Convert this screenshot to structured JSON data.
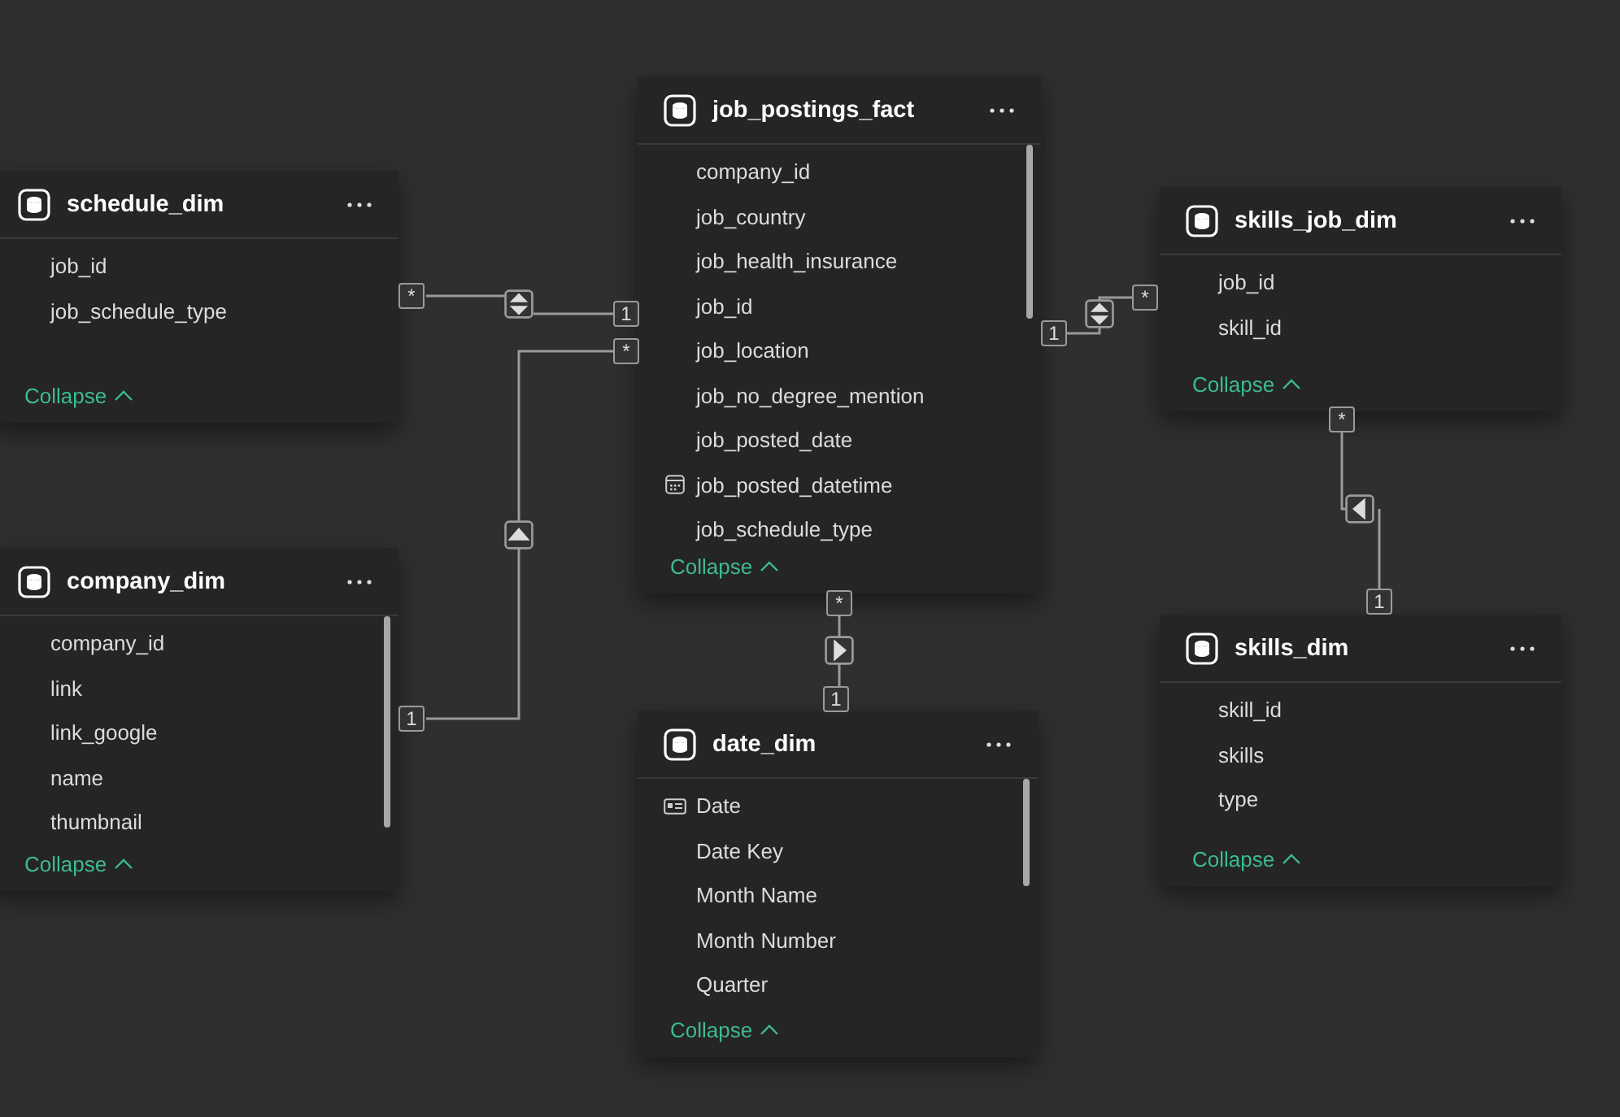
{
  "tables": [
    {
      "name": "schedule_dim",
      "scrollable": false,
      "fields": [
        {
          "name": "job_id",
          "kind": "plain"
        },
        {
          "name": "job_schedule_type",
          "kind": "plain"
        }
      ],
      "collapse": "Collapse"
    },
    {
      "name": "company_dim",
      "scrollable": true,
      "fields": [
        {
          "name": "company_id",
          "kind": "plain"
        },
        {
          "name": "link",
          "kind": "plain"
        },
        {
          "name": "link_google",
          "kind": "plain"
        },
        {
          "name": "name",
          "kind": "plain"
        },
        {
          "name": "thumbnail",
          "kind": "plain"
        }
      ],
      "collapse": "Collapse"
    },
    {
      "name": "job_postings_fact",
      "scrollable": true,
      "fields": [
        {
          "name": "company_id",
          "kind": "plain"
        },
        {
          "name": "job_country",
          "kind": "plain"
        },
        {
          "name": "job_health_insurance",
          "kind": "plain"
        },
        {
          "name": "job_id",
          "kind": "plain"
        },
        {
          "name": "job_location",
          "kind": "plain"
        },
        {
          "name": "job_no_degree_mention",
          "kind": "plain"
        },
        {
          "name": "job_posted_date",
          "kind": "plain"
        },
        {
          "name": "job_posted_datetime",
          "kind": "calendar"
        },
        {
          "name": "job_schedule_type",
          "kind": "plain"
        }
      ],
      "collapse": "Collapse"
    },
    {
      "name": "date_dim",
      "scrollable": true,
      "fields": [
        {
          "name": "Date",
          "kind": "card"
        },
        {
          "name": "Date Key",
          "kind": "plain"
        },
        {
          "name": "Month Name",
          "kind": "plain"
        },
        {
          "name": "Month Number",
          "kind": "plain"
        },
        {
          "name": "Quarter",
          "kind": "plain"
        }
      ],
      "collapse": "Collapse"
    },
    {
      "name": "skills_job_dim",
      "scrollable": false,
      "fields": [
        {
          "name": "job_id",
          "kind": "plain"
        },
        {
          "name": "skill_id",
          "kind": "plain"
        }
      ],
      "collapse": "Collapse"
    },
    {
      "name": "skills_dim",
      "scrollable": false,
      "fields": [
        {
          "name": "skill_id",
          "kind": "plain"
        },
        {
          "name": "skills",
          "kind": "plain"
        },
        {
          "name": "type",
          "kind": "plain"
        }
      ],
      "collapse": "Collapse"
    }
  ],
  "relationships": [
    {
      "many_end": "*",
      "one_end": "1",
      "kind": "both"
    },
    {
      "many_end": "*",
      "one_end": "1",
      "kind": "up"
    },
    {
      "many_end": "*",
      "one_end": "1",
      "kind": "both"
    },
    {
      "many_end": "*",
      "one_end": "1",
      "kind": "right"
    },
    {
      "many_end": "*",
      "one_end": "1",
      "kind": "left"
    }
  ]
}
